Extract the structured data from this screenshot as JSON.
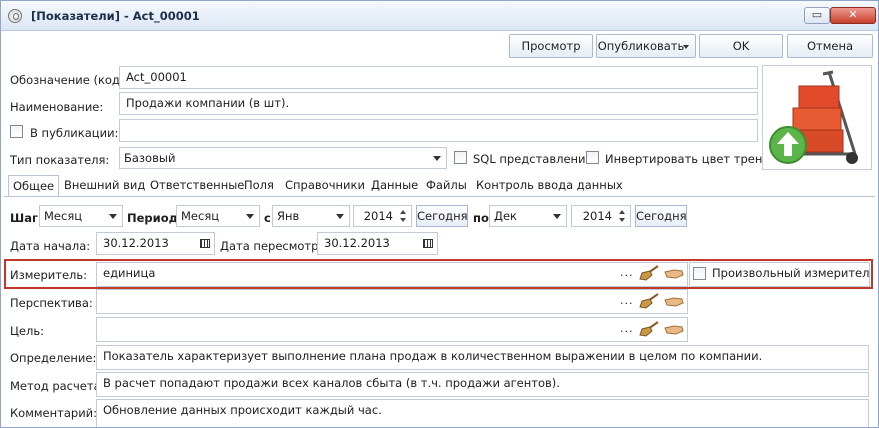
{
  "window": {
    "title": "[Показатели] - Act_00001",
    "min_label": "▭",
    "close_label": "✕"
  },
  "toolbar": {
    "preview": "Просмотр",
    "publish": "Опубликовать",
    "ok": "OK",
    "cancel": "Отмена"
  },
  "header": {
    "code_label": "Обозначение (код):",
    "code_value": "Act_00001",
    "name_label": "Наименование:",
    "name_value": "Продажи компании (в шт).",
    "publication_label": "В публикации:",
    "type_label": "Тип показателя:",
    "type_value": "Базовый",
    "sql_label": "SQL представление",
    "invert_label": "Инвертировать цвет тренда"
  },
  "tabs": [
    "Общее",
    "Внешний вид",
    "Ответственные",
    "Поля",
    "Справочники",
    "Данные",
    "Файлы",
    "Контроль ввода данных"
  ],
  "period": {
    "step_label": "Шаг:",
    "step_value": "Месяц",
    "period_label": "Период:",
    "period_value": "Месяц",
    "from_label": "с",
    "from_month": "Янв",
    "from_year": "2014",
    "today1": "Сегодня",
    "to_label": "по",
    "to_month": "Дек",
    "to_year": "2014",
    "today2": "Сегодня"
  },
  "dates": {
    "start_label": "Дата начала:",
    "start_value": "30.12.2013",
    "review_label": "Дата пересмотра:",
    "review_value": "30.12.2013"
  },
  "fields": {
    "meter_label": "Измеритель:",
    "meter_value": "единица",
    "arbitrary_label": "Произвольный измеритель",
    "perspective_label": "Перспектива:",
    "goal_label": "Цель:",
    "definition_label": "Определение:",
    "definition_value": "Показатель характеризует выполнение плана продаж в количественном выражении в целом по компании.",
    "method_label": "Метод расчета:",
    "method_value": "В расчет попадают продажи всех каналов сбыта (в т.ч. продажи агентов).",
    "comment_label": "Комментарий:",
    "comment_value": "Обновление данных происходит каждый час.",
    "dots": "..."
  }
}
